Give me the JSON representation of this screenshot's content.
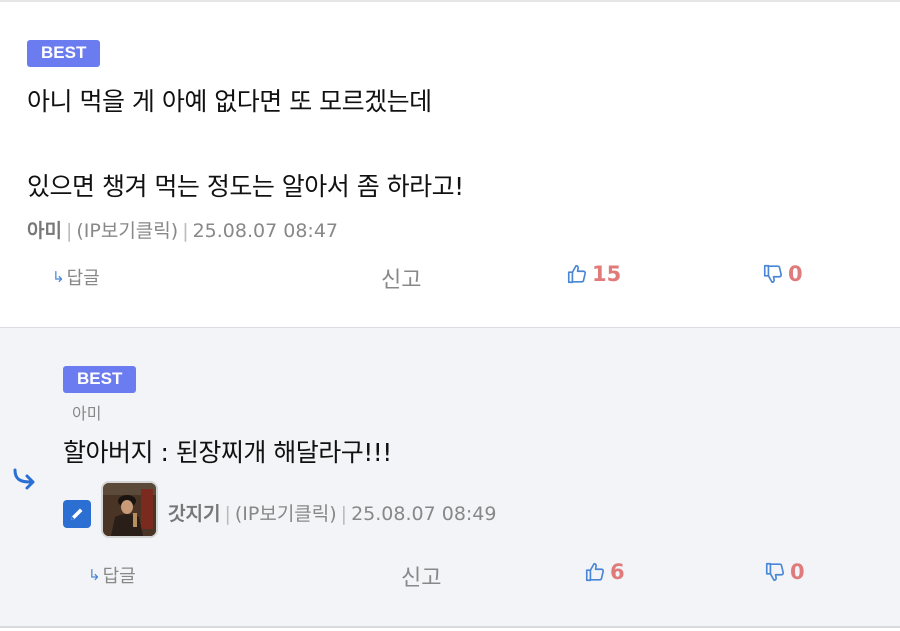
{
  "comments": [
    {
      "badge": "BEST",
      "lines": [
        "아니 먹을 게 아예 없다면 또 모르겠는데",
        "",
        "있으면 챙겨 먹는 정도는 알아서 좀 하라고!"
      ],
      "author": "아미",
      "ip": "(IP보기클릭)",
      "date": "25.08.07 08:47",
      "reply_label": "답글",
      "report_label": "신고",
      "likes": "15",
      "dislikes": "0"
    },
    {
      "badge": "BEST",
      "reply_to": "아미",
      "lines": [
        "할아버지 : 된장찌개 해달라구!!!"
      ],
      "author": "갓지기",
      "ip": "(IP보기클릭)",
      "date": "25.08.07 08:49",
      "reply_label": "답글",
      "report_label": "신고",
      "likes": "6",
      "dislikes": "0"
    }
  ],
  "icons": {
    "reply_arrow": "reply-arrow-icon",
    "thumbs_up": "thumbs-up-icon",
    "thumbs_down": "thumbs-down-icon",
    "edit": "pencil-icon"
  },
  "colors": {
    "badge": "#6b7cf0",
    "count": "#e07b7b",
    "accent": "#4a86d6",
    "reply_bg": "#f3f4f7"
  }
}
